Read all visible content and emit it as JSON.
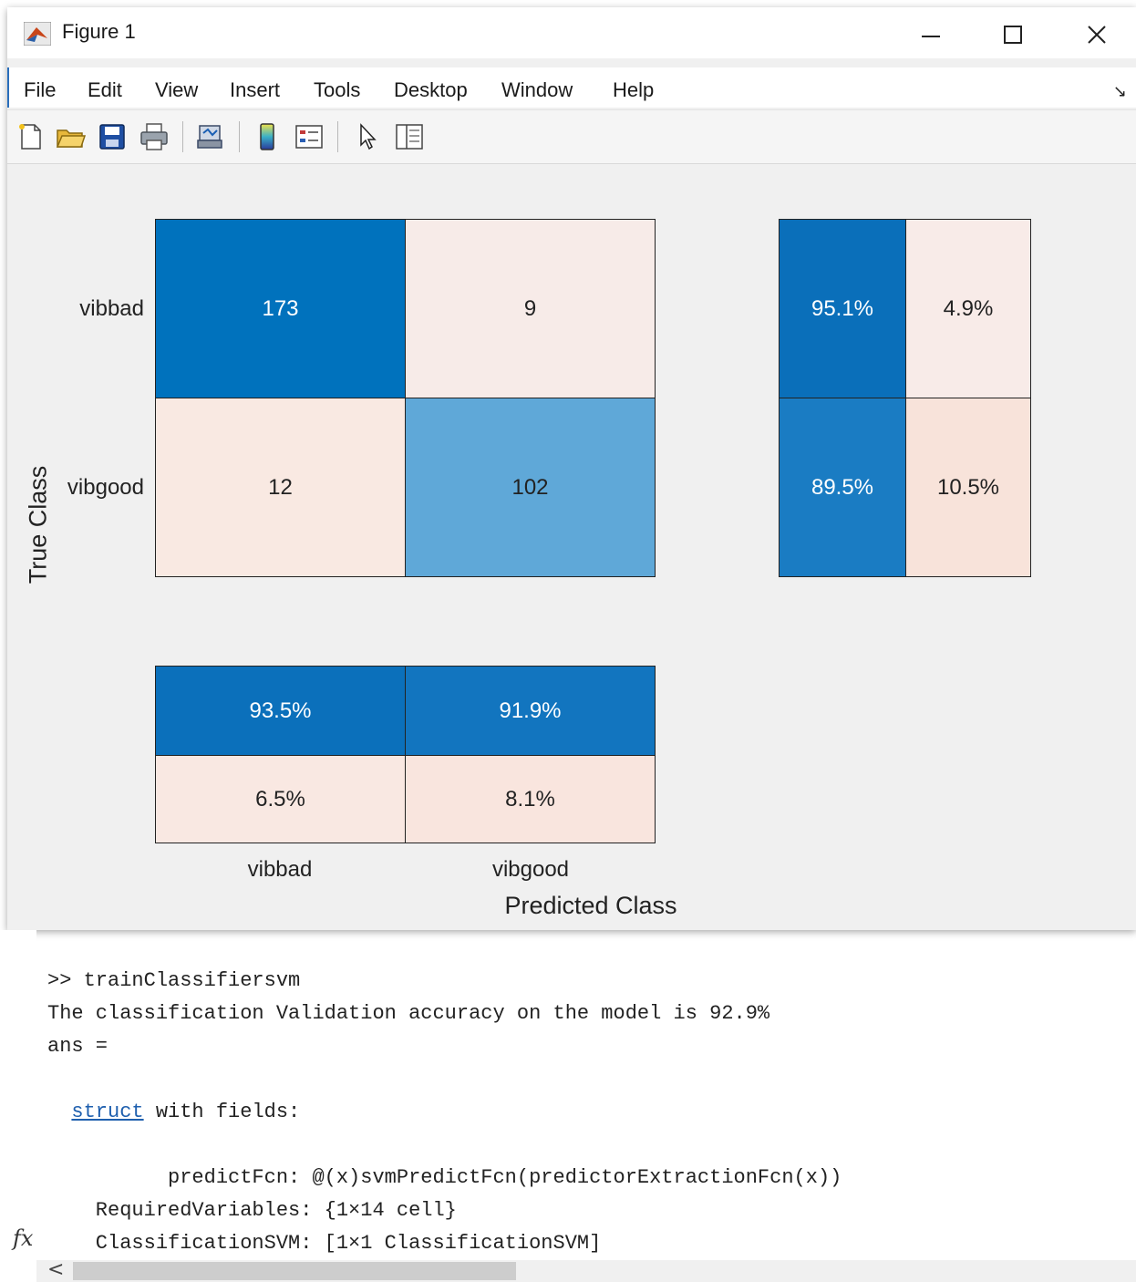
{
  "window": {
    "title": "Figure 1",
    "minimize_glyph": "—",
    "maximize_glyph": "☐",
    "close_glyph": "✕"
  },
  "menu": {
    "items": [
      "File",
      "Edit",
      "View",
      "Insert",
      "Tools",
      "Desktop",
      "Window",
      "Help"
    ],
    "overflow_glyph": "↘"
  },
  "toolbar": {
    "icons": [
      "new-figure-icon",
      "open-file-icon",
      "save-icon",
      "print-icon",
      "link-plot-icon",
      "insert-colorbar-icon",
      "insert-legend-icon",
      "edit-plot-icon",
      "property-inspector-icon"
    ]
  },
  "colors": {
    "dark_blue": "#0072bd",
    "mid_blue": "#1a7dc4",
    "light_blue": "#5fa8d8",
    "pale_pink": "#f7ebe8",
    "pale_pink_2": "#f9e5de",
    "link": "#1e5fae"
  },
  "chart_data": {
    "type": "heatmap",
    "title": "",
    "xlabel": "Predicted Class",
    "ylabel": "True Class",
    "categories": [
      "vibbad",
      "vibgood"
    ],
    "confusion_matrix": [
      [
        173,
        9
      ],
      [
        12,
        102
      ]
    ],
    "row_summary": [
      [
        "95.1%",
        "4.9%"
      ],
      [
        "89.5%",
        "10.5%"
      ]
    ],
    "column_summary": [
      [
        "93.5%",
        "91.9%"
      ],
      [
        "6.5%",
        "8.1%"
      ]
    ]
  },
  "command_window": {
    "line1": ">> trainClassifiersvm",
    "line2": "The classification Validation accuracy on the model is 92.9%",
    "line3": "ans =",
    "struct_link": "struct",
    "struct_rest": " with fields:",
    "field1": "          predictFcn: @(x)svmPredictFcn(predictorExtractionFcn(x))",
    "field2": "    RequiredVariables: {1×14 cell}",
    "field3": "    ClassificationSVM: [1×1 ClassificationSVM]",
    "fx_label": "fx",
    "scroll_left_glyph": "<"
  }
}
